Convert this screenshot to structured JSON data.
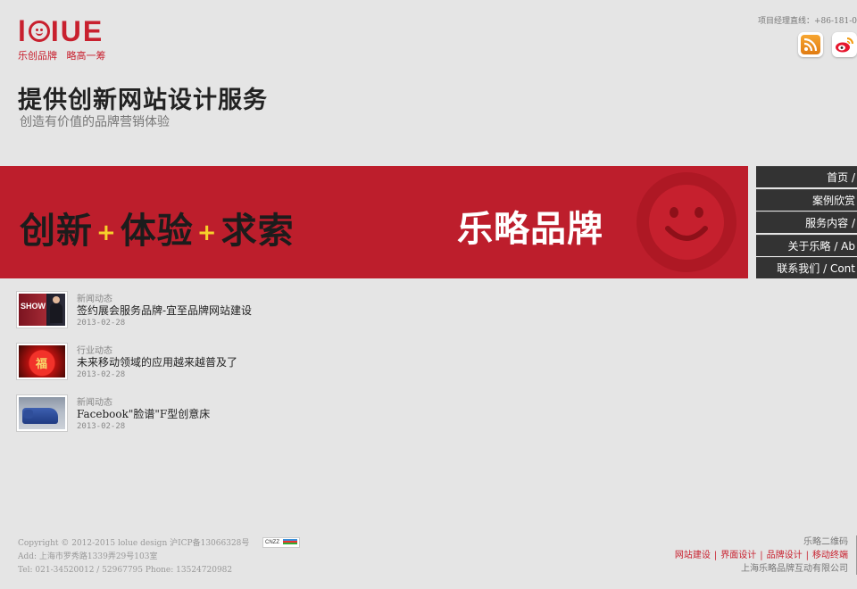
{
  "logo": {
    "word_left": "lo",
    "word_right": "IUE",
    "tag_red": "乐创品牌",
    "tag_dark": "略高一筹"
  },
  "header": {
    "contact": "项目经理直线：+86-181-0"
  },
  "headline": {
    "title": "提供创新网站设计服务",
    "subtitle": "创造有价值的品牌营销体验"
  },
  "banner": {
    "slogan_1": "创新",
    "slogan_2": "体验",
    "slogan_3": "求索",
    "plus": "+",
    "brand": "乐略品牌"
  },
  "nav": [
    {
      "label": "首页 /"
    },
    {
      "label": "案例欣赏"
    },
    {
      "label": "服务内容 /"
    },
    {
      "label": "关于乐略 / Ab"
    },
    {
      "label": "联系我们 / Cont"
    }
  ],
  "news": [
    {
      "category": "新闻动态",
      "title": "签约展会服务品牌-宜至品牌网站建设",
      "date": "2013-02-28",
      "thumb_text": "SHOW"
    },
    {
      "category": "行业动态",
      "title": "未来移动领域的应用越来越普及了",
      "date": "2013-02-28",
      "thumb_text": "福"
    },
    {
      "category": "新闻动态",
      "title": "Facebook\"脸谱\"F型创意床",
      "date": "2013-02-28"
    }
  ],
  "footer": {
    "copyright": "Copyright © 2012-2015 lolue design 沪ICP备13066328号",
    "address": "Add: 上海市罗秀路1339弄29号103室",
    "phone": "Tel: 021-34520012 / 52967795 Phone: 13524720982",
    "cnzz": "CNZZ",
    "qr_label": "乐略二维码",
    "links": [
      "网站建设",
      "界面设计",
      "品牌设计",
      "移动终端"
    ],
    "separator": "|",
    "company": "上海乐略品牌互动有限公司"
  },
  "colors": {
    "brand_red": "#bd1e2c",
    "nav_bg": "#333333",
    "page_bg": "#e5e5e5"
  }
}
